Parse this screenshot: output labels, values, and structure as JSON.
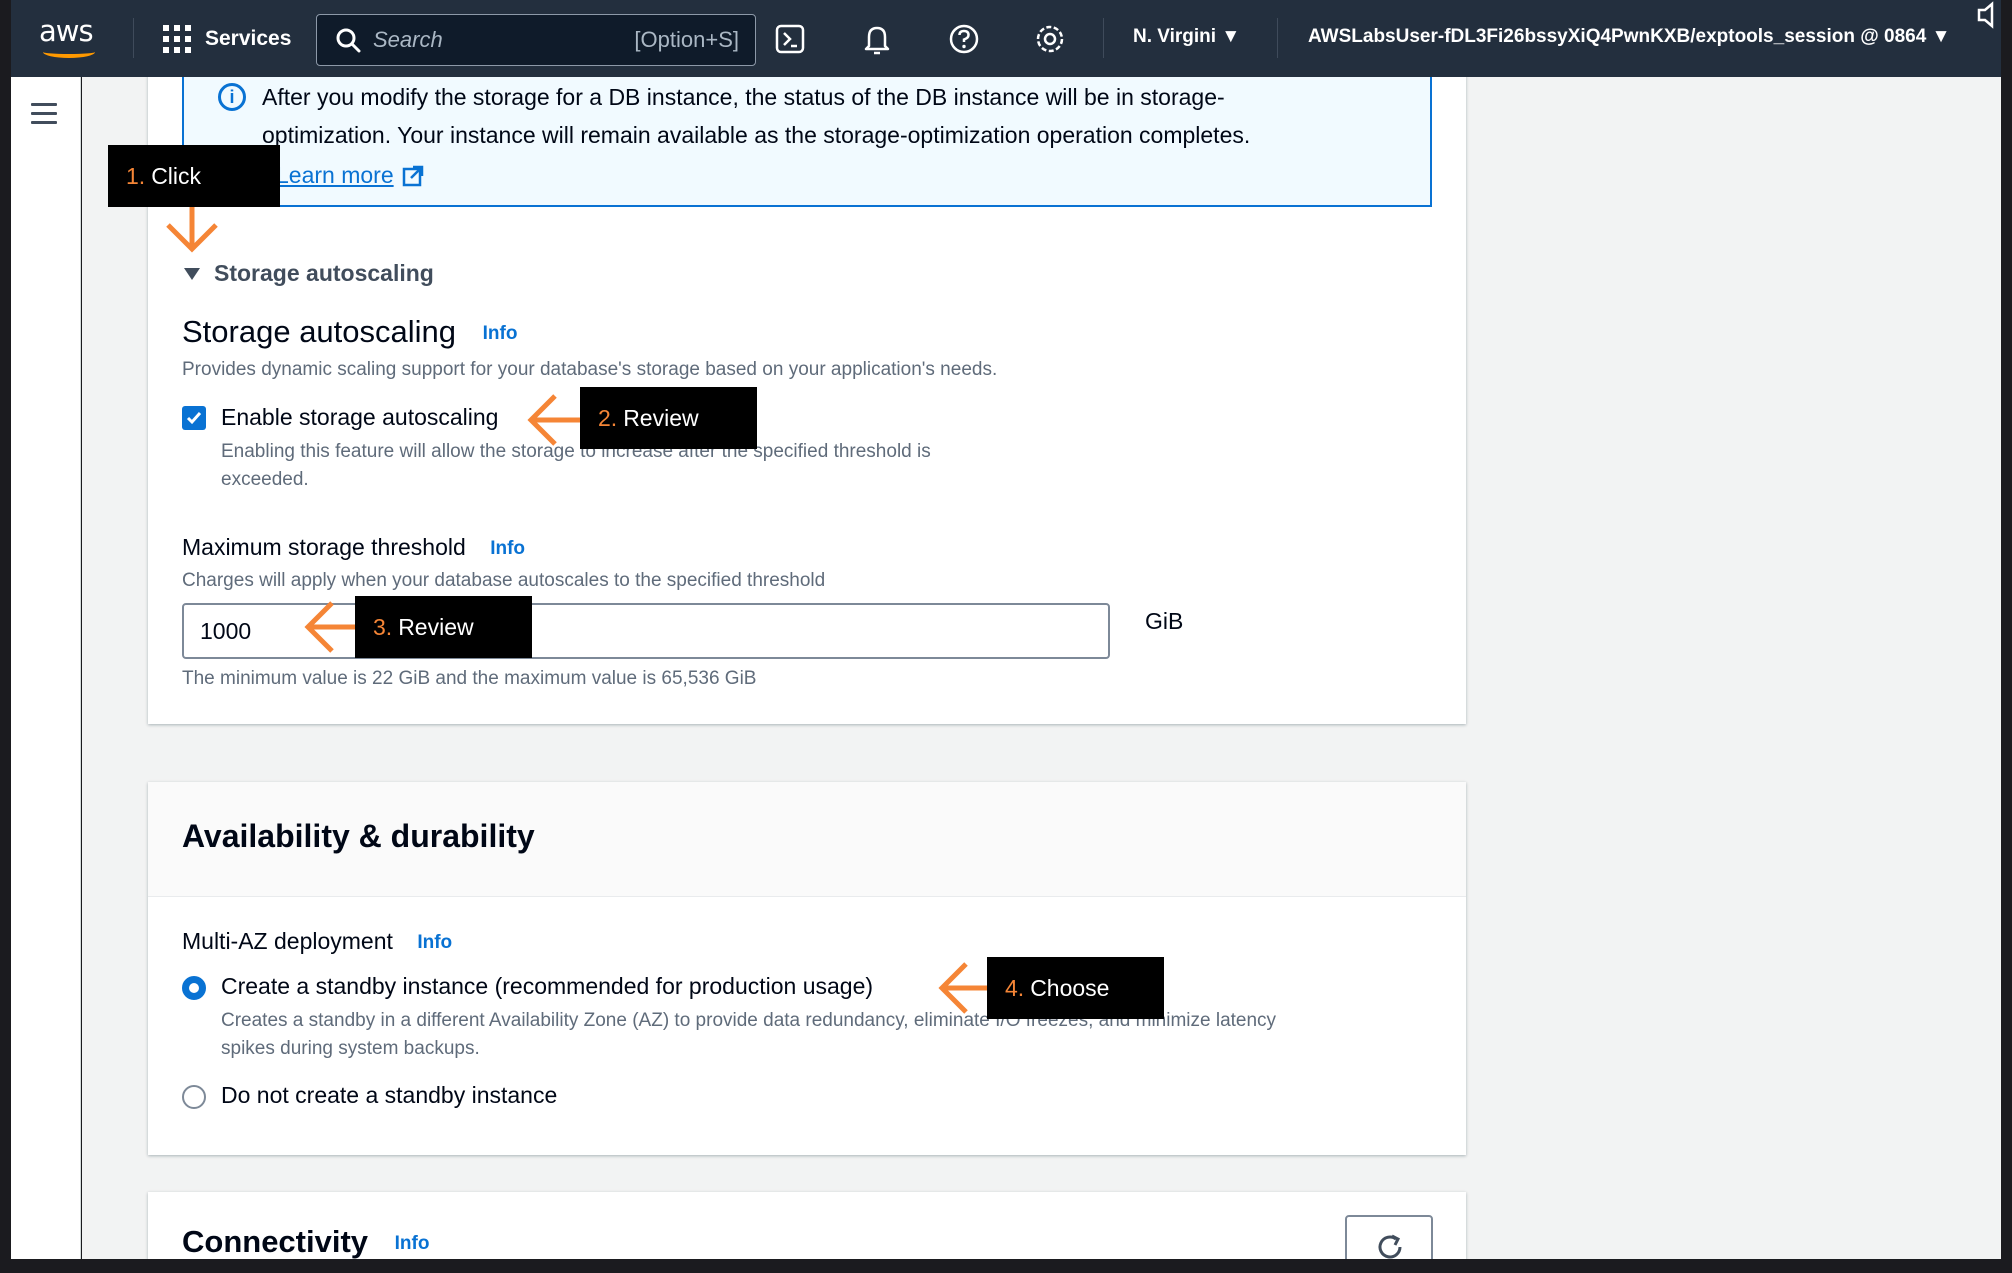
{
  "nav": {
    "logo_text": "aws",
    "services_label": "Services",
    "search_placeholder": "Search",
    "search_shortcut": "[Option+S]",
    "region": "N. Virgini ▼",
    "account": "AWSLabsUser-fDL3Fi26bssyXiQ4PwnKXB/exptools_session @ 0864 ▼"
  },
  "info_alert": {
    "line1": "After you modify the storage for a DB instance, the status of the DB instance will be in storage-",
    "line2": "optimization. Your instance will remain available as the storage-optimization operation completes.",
    "learn_more": "Learn more"
  },
  "storage_autoscaling": {
    "expander_label": "Storage autoscaling",
    "title": "Storage autoscaling",
    "info": "Info",
    "description": "Provides dynamic scaling support for your database's storage based on your application's needs.",
    "checkbox_label": "Enable storage autoscaling",
    "checkbox_checked": true,
    "checkbox_help_1": "Enabling this feature will allow the storage to increase after the specified threshold is",
    "checkbox_help_2": "exceeded.",
    "threshold_label": "Maximum storage threshold",
    "threshold_info": "Info",
    "threshold_desc": "Charges will apply when your database autoscales to the specified threshold",
    "threshold_value": "1000",
    "unit": "GiB",
    "constraint": "The minimum value is 22 GiB and the maximum value is 65,536 GiB"
  },
  "availability": {
    "title": "Availability & durability",
    "multi_az_label": "Multi-AZ deployment",
    "info": "Info",
    "option1_label": "Create a standby instance (recommended for production usage)",
    "option1_help_1": "Creates a standby in a different Availability Zone (AZ) to provide data redundancy, eliminate I/O freezes, and minimize latency",
    "option1_help_2": "spikes during system backups.",
    "option1_selected": true,
    "option2_label": "Do not create a standby instance"
  },
  "connectivity": {
    "title": "Connectivity",
    "info": "Info"
  },
  "callouts": [
    {
      "num": "1.",
      "text": "Click"
    },
    {
      "num": "2.",
      "text": "Review"
    },
    {
      "num": "3.",
      "text": "Review"
    },
    {
      "num": "4.",
      "text": "Choose"
    }
  ],
  "colors": {
    "nav_bg": "#232f3e",
    "accent_blue": "#0972d3",
    "callout_orange": "#f58536",
    "aws_orange": "#ff9900"
  }
}
